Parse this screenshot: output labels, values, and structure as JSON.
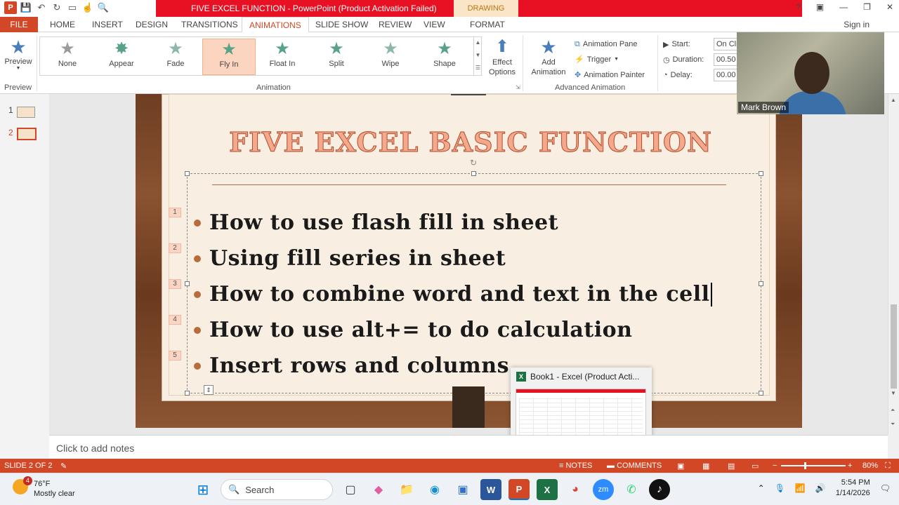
{
  "window": {
    "title": "FIVE EXCEL FUNCTION -  PowerPoint (Product Activation Failed)",
    "context_tab_group": "DRAWING TOOLS",
    "help": "?",
    "restore_ribbon": "▣",
    "minimize": "—",
    "maximize": "❐",
    "close": "✕"
  },
  "ribbon_tabs": [
    "FILE",
    "HOME",
    "INSERT",
    "DESIGN",
    "TRANSITIONS",
    "ANIMATIONS",
    "SLIDE SHOW",
    "REVIEW",
    "VIEW",
    "FORMAT"
  ],
  "sign_in": "Sign in",
  "ribbon": {
    "preview_label": "Preview",
    "preview_group": "Preview",
    "animations": [
      {
        "label": "None",
        "selected": false
      },
      {
        "label": "Appear",
        "selected": false
      },
      {
        "label": "Fade",
        "selected": false
      },
      {
        "label": "Fly In",
        "selected": true
      },
      {
        "label": "Float In",
        "selected": false
      },
      {
        "label": "Split",
        "selected": false
      },
      {
        "label": "Wipe",
        "selected": false
      },
      {
        "label": "Shape",
        "selected": false
      }
    ],
    "animation_group": "Animation",
    "effect_options": "Effect Options",
    "add_animation": "Add Animation",
    "animation_pane": "Animation Pane",
    "trigger": "Trigger",
    "animation_painter": "Animation Painter",
    "advanced_group": "Advanced Animation",
    "start_label": "Start:",
    "start_value": "On Click",
    "duration_label": "Duration:",
    "duration_value": "00.50",
    "delay_label": "Delay:",
    "delay_value": "00.00"
  },
  "thumbnails": [
    "1",
    "2"
  ],
  "slide": {
    "title": "FIVE EXCEL BASIC FUNCTION",
    "bullets": [
      {
        "tag": "1",
        "text": "How to use flash fill in sheet"
      },
      {
        "tag": "2",
        "text": "Using fill series in sheet"
      },
      {
        "tag": "3",
        "text": "How to combine word and text in the cell"
      },
      {
        "tag": "4",
        "text": "How to use alt+= to do calculation"
      },
      {
        "tag": "5",
        "text": "Insert rows and columns"
      }
    ]
  },
  "excel_preview": {
    "title": "Book1 - Excel (Product Acti..."
  },
  "notes_placeholder": "Click to add notes",
  "status": {
    "slide_indicator": "SLIDE 2 OF 2",
    "notes_btn": "NOTES",
    "comments_btn": "COMMENTS",
    "zoom": "80%"
  },
  "webcam": {
    "name": "Mark Brown"
  },
  "taskbar": {
    "weather_temp": "76°F",
    "weather_desc": "Mostly clear",
    "weather_badge": "4",
    "search_placeholder": "Search",
    "time": "5:54 PM",
    "date": "1/14/2026"
  },
  "colors": {
    "accent": "#d24726",
    "title_bar": "#e81123",
    "slide_title": "#f4a98c"
  }
}
